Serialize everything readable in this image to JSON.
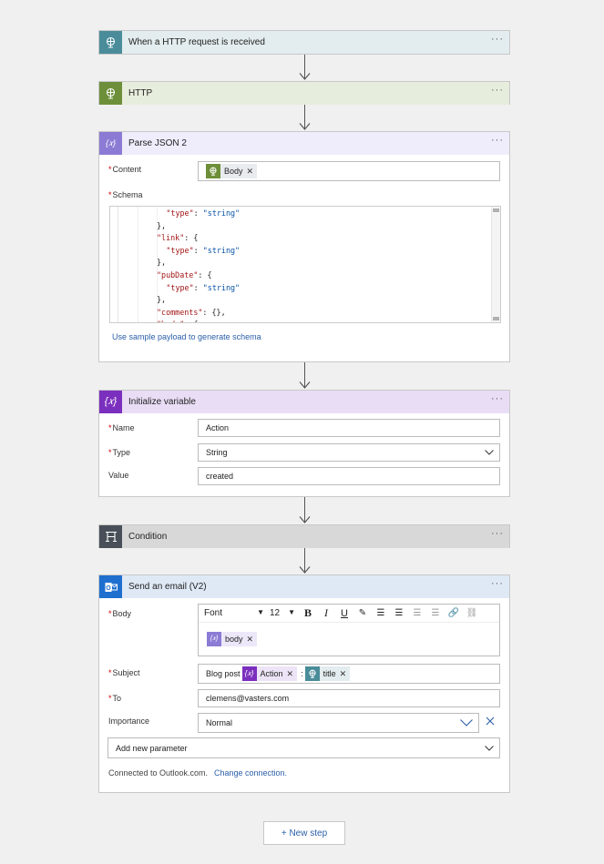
{
  "steps": {
    "trigger": {
      "title": "When a HTTP request is received",
      "icon": "globe-icon",
      "color": "#4a8c9a"
    },
    "http": {
      "title": "HTTP",
      "icon": "globe-icon",
      "color": "#6e8f3a"
    },
    "parse": {
      "title": "Parse JSON 2",
      "icon": "braces-icon",
      "color": "#8c7bd4",
      "content_label": "Content",
      "content_token": "Body",
      "schema_label": "Schema",
      "schema_lines": [
        {
          "indent": 6,
          "parts": [
            [
              "k",
              "\"type\""
            ],
            [
              "p",
              ": "
            ],
            [
              "s",
              "\"string\""
            ]
          ]
        },
        {
          "indent": 4,
          "parts": [
            [
              "p",
              "},"
            ]
          ]
        },
        {
          "indent": 4,
          "parts": [
            [
              "k",
              "\"link\""
            ],
            [
              "p",
              ": {"
            ]
          ]
        },
        {
          "indent": 6,
          "parts": [
            [
              "k",
              "\"type\""
            ],
            [
              "p",
              ": "
            ],
            [
              "s",
              "\"string\""
            ]
          ]
        },
        {
          "indent": 4,
          "parts": [
            [
              "p",
              "},"
            ]
          ]
        },
        {
          "indent": 4,
          "parts": [
            [
              "k",
              "\"pubDate\""
            ],
            [
              "p",
              ": {"
            ]
          ]
        },
        {
          "indent": 6,
          "parts": [
            [
              "k",
              "\"type\""
            ],
            [
              "p",
              ": "
            ],
            [
              "s",
              "\"string\""
            ]
          ]
        },
        {
          "indent": 4,
          "parts": [
            [
              "p",
              "},"
            ]
          ]
        },
        {
          "indent": 4,
          "parts": [
            [
              "k",
              "\"comments\""
            ],
            [
              "p",
              ": {},"
            ]
          ]
        },
        {
          "indent": 4,
          "parts": [
            [
              "k",
              "\"body\""
            ],
            [
              "p",
              ": {"
            ]
          ]
        }
      ],
      "sample_link": "Use sample payload to generate schema"
    },
    "initvar": {
      "title": "Initialize variable",
      "icon": "variable-icon",
      "color": "#7b2fbe",
      "name_label": "Name",
      "name_value": "Action",
      "type_label": "Type",
      "type_value": "String",
      "value_label": "Value",
      "value_value": "created"
    },
    "condition": {
      "title": "Condition",
      "icon": "condition-icon",
      "color": "#484f58"
    },
    "email": {
      "title": "Send an email (V2)",
      "icon": "outlook-icon",
      "color": "#1f6fcf",
      "body_label": "Body",
      "font_label": "Font",
      "size_label": "12",
      "body_token": "body",
      "subject_label": "Subject",
      "subject_prefix": "Blog post",
      "subject_token1": "Action",
      "subject_sep": ":",
      "subject_token2": "title",
      "to_label": "To",
      "to_value": "clemens@vasters.com",
      "importance_label": "Importance",
      "importance_value": "Normal",
      "add_param": "Add new parameter",
      "connected_text": "Connected to Outlook.com.",
      "change_conn": "Change connection."
    }
  },
  "more_label": "···",
  "new_step": "+ New step"
}
